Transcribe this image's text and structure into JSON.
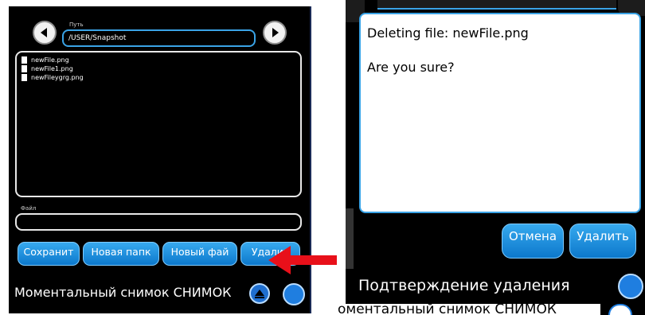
{
  "file_browser": {
    "path_label": "Путь",
    "path_value": "/USER/Snapshot",
    "files": [
      "newFile.png",
      "newFile1.png",
      "newFileygrg.png"
    ],
    "file_label": "Файл",
    "file_value": "",
    "buttons": {
      "save": "Сохранит",
      "new_folder": "Новая папк",
      "new_file": "Новый фай",
      "delete": "Удалит"
    },
    "status_title": "Моментальный снимок СНИМОК"
  },
  "confirm_dialog": {
    "message_line1": "Deleting file: newFile.png",
    "message_line2": "Are you sure?",
    "cancel_label": "Отмена",
    "delete_label": "Удалить",
    "title": "Подтверждение удаления",
    "behind_title": "оментальный снимок СНИМОК"
  },
  "colors": {
    "accent": "#1a8fe3",
    "arrow": "#e8101a"
  },
  "icons": {
    "back": "back-arrow-icon",
    "forward": "forward-arrow-icon",
    "file": "file-icon",
    "up": "up-arrow-icon",
    "annotation": "red-arrow-icon"
  }
}
